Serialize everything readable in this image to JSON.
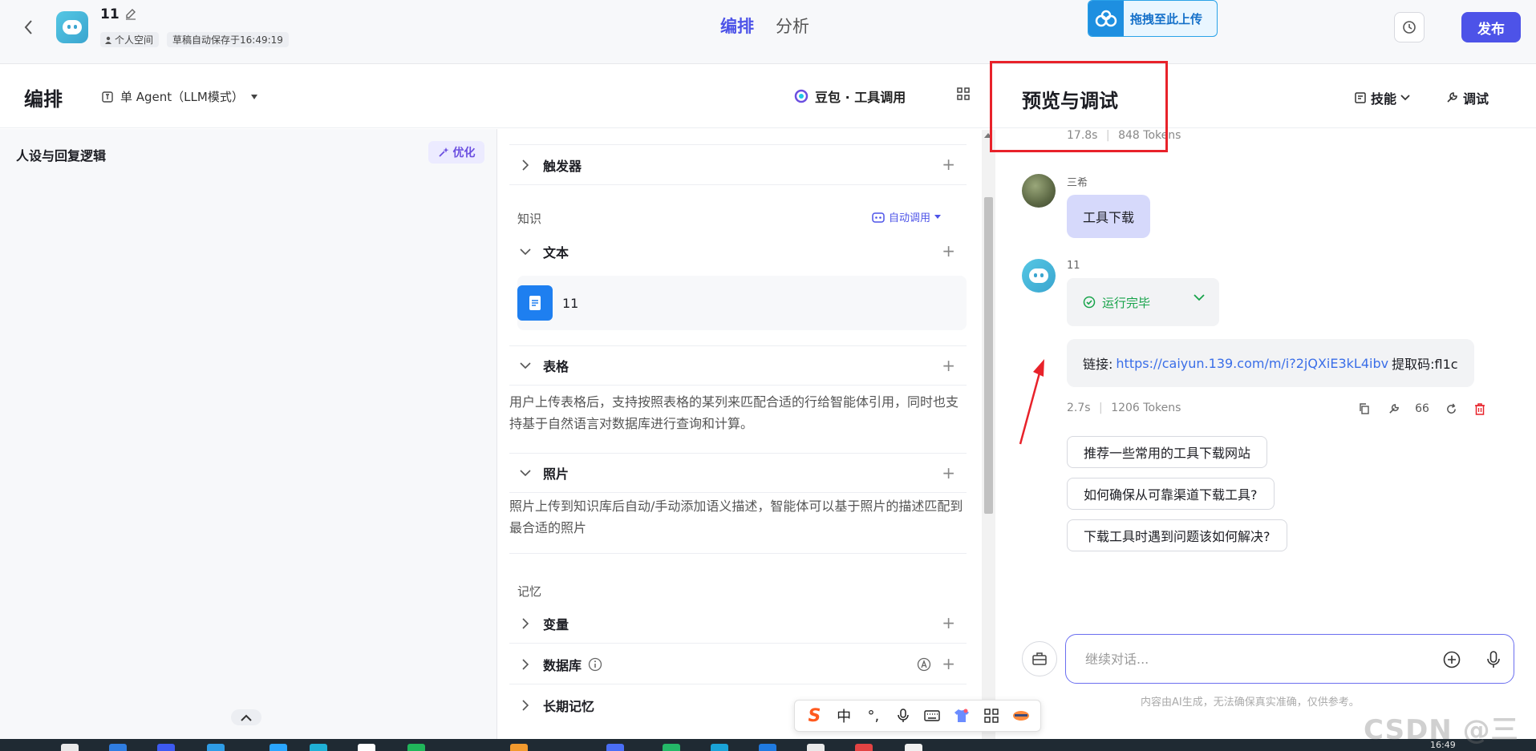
{
  "header": {
    "bot_name": "11",
    "space_label": "个人空间",
    "save_status": "草稿自动保存于16:49:19",
    "tabs": [
      "编排",
      "分析"
    ],
    "upload_label": "拖拽至此上传",
    "publish_label": "发布"
  },
  "toolbar": {
    "title": "编排",
    "agent_mode": "单 Agent（LLM模式）",
    "model": "豆包 · 工具调用",
    "preview_title": "预览与调试",
    "skills_label": "技能",
    "debug_label": "调试"
  },
  "left": {
    "persona_title": "人设与回复逻辑",
    "optimize_label": "优化"
  },
  "middle": {
    "trigger_label": "触发器",
    "knowledge_label": "知识",
    "auto_call_label": "自动调用",
    "text_label": "文本",
    "kb_item_name": "11",
    "table_label": "表格",
    "table_desc": "用户上传表格后，支持按照表格的某列来匹配合适的行给智能体引用，同时也支持基于自然语言对数据库进行查询和计算。",
    "photo_label": "照片",
    "photo_desc": "照片上传到知识库后自动/手动添加语义描述，智能体可以基于照片的描述匹配到最合适的照片",
    "memory_label": "记忆",
    "variable_label": "变量",
    "database_label": "数据库",
    "longterm_label": "长期记忆"
  },
  "chat": {
    "prev_meta_time": "17.8s",
    "prev_meta_tokens": "848 Tokens",
    "user_name": "三希",
    "user_message": "工具下载",
    "bot_name": "11",
    "run_status": "运行完毕",
    "answer_prefix": "链接:",
    "answer_link": "https://caiyun.139.com/m/i?2jQXiE3kL4ibv",
    "answer_suffix": "提取码:fl1c",
    "meta_time": "2.7s",
    "meta_tokens": "1206 Tokens",
    "quote_count": "66",
    "suggestions": [
      "推荐一些常用的工具下载网站",
      "如何确保从可靠渠道下载工具?",
      "下载工具时遇到问题该如何解决?"
    ],
    "input_placeholder": "继续对话...",
    "disclaimer": "内容由AI生成，无法确保真实准确，仅供参考。"
  },
  "ime": {
    "chinese_label": "中",
    "punct_label": "°,"
  },
  "taskbar": {
    "time": "16:49"
  },
  "watermark": "CSDN @三希",
  "colors": {
    "accent": "#4d53e8",
    "success": "#17a34a",
    "annotation_red": "#e8222a",
    "link": "#3a6ee8"
  }
}
